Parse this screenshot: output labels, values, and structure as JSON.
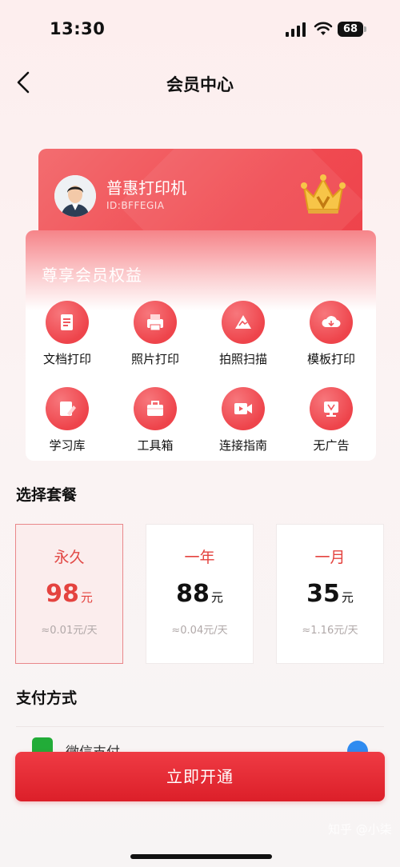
{
  "status_bar": {
    "time": "13:30",
    "battery": "68"
  },
  "nav": {
    "title": "会员中心"
  },
  "member": {
    "name": "普惠打印机",
    "id": "ID:BFFEGIA"
  },
  "benefits": {
    "title": "尊享会员权益",
    "items": [
      {
        "label": "文档打印",
        "icon": "document-icon"
      },
      {
        "label": "照片打印",
        "icon": "photo-print-icon"
      },
      {
        "label": "拍照扫描",
        "icon": "scan-icon"
      },
      {
        "label": "模板打印",
        "icon": "template-cloud-icon"
      },
      {
        "label": "学习库",
        "icon": "study-library-icon"
      },
      {
        "label": "工具箱",
        "icon": "toolbox-icon"
      },
      {
        "label": "连接指南",
        "icon": "video-guide-icon"
      },
      {
        "label": "无广告",
        "icon": "no-ads-icon"
      }
    ]
  },
  "plans": {
    "title": "选择套餐",
    "items": [
      {
        "name": "永久",
        "price": "98",
        "unit": "元",
        "daily": "≈0.01元/天",
        "selected": true
      },
      {
        "name": "一年",
        "price": "88",
        "unit": "元",
        "daily": "≈0.04元/天",
        "selected": false
      },
      {
        "name": "一月",
        "price": "35",
        "unit": "元",
        "daily": "≈1.16元/天",
        "selected": false
      }
    ]
  },
  "payment": {
    "title": "支付方式",
    "method": "微信支付"
  },
  "action": {
    "open_label": "立即开通"
  },
  "watermark": "知乎 @小柒",
  "colors": {
    "accent": "#e4433f",
    "button": "#e52d36",
    "wechat": "#22ac38",
    "check": "#2f8bf0"
  }
}
